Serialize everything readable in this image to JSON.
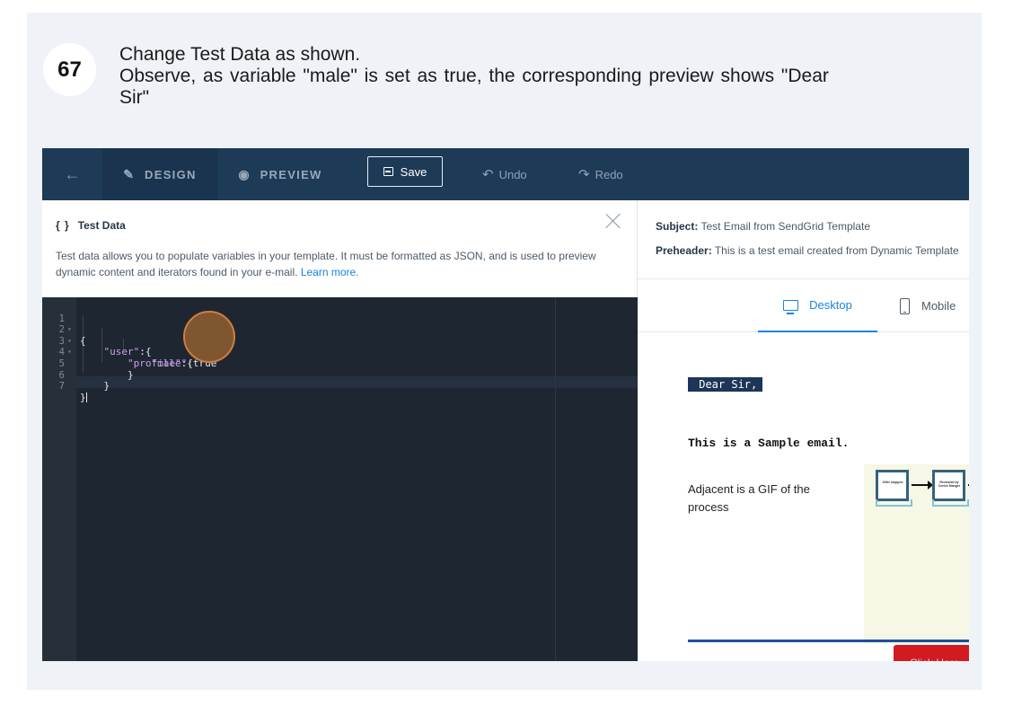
{
  "step": {
    "number": "67",
    "line1": "Change Test Data as shown.",
    "line2": "Observe, as variable \"male\" is set as true, the corresponding preview shows \"Dear",
    "line3": "Sir\""
  },
  "toolbar": {
    "back_icon": "←",
    "design_label": "DESIGN",
    "preview_label": "PREVIEW",
    "save_label": "Save",
    "undo_label": "Undo",
    "redo_label": "Redo",
    "colors": {
      "bar": "#1d3a57",
      "active_tab": "#1a344f"
    }
  },
  "test_data": {
    "title": "Test Data",
    "title_icon": "{ }",
    "description": "Test data allows you to populate variables in your template. It must be formatted as JSON, and is used to preview dynamic content and iterators found in your e-mail.",
    "learn_more": "Learn more."
  },
  "editor": {
    "line_numbers": [
      "1",
      "2",
      "3",
      "4",
      "5",
      "6",
      "7"
    ],
    "line1": "{",
    "key_user": "\"user\"",
    "key_profile": "\"profile\"",
    "key_male": "\"male\"",
    "value_male": "true",
    "colon_brace": ":{",
    "colon": ":",
    "close_brace": "}",
    "last_line": "}"
  },
  "preview": {
    "subject_label": "Subject:",
    "subject_value": "Test Email from SendGrid Template",
    "preheader_label": "Preheader:",
    "preheader_value": "This is a test email created from Dynamic Template",
    "tab_desktop": "Desktop",
    "tab_mobile": "Mobile",
    "greeting": " Dear Sir,",
    "sample_heading": "This is a Sample email.",
    "gif_text": "Adjacent is a GIF of the process",
    "gif_box1": "Offer mapped",
    "gif_box2": "Reviewed by Centre Manger",
    "cta_label": "Click Here",
    "accent_color": "#1a82e2"
  }
}
